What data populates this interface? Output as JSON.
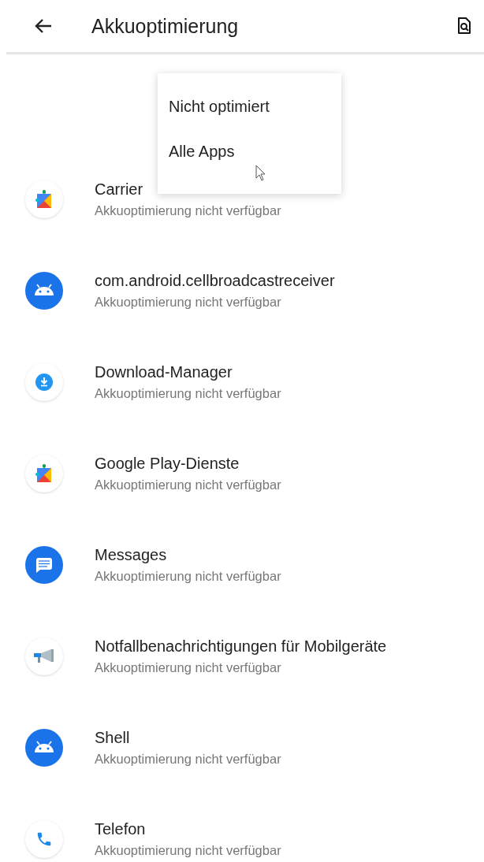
{
  "app_bar": {
    "title": "Akkuoptimierung"
  },
  "filter_menu": {
    "items": [
      "Nicht optimiert",
      "Alle Apps"
    ]
  },
  "apps": [
    {
      "name": "Carrier",
      "status": "Akkuoptimierung nicht verfügbar",
      "kind": "puzzle"
    },
    {
      "name": "com.android.cellbroadcastreceiver",
      "status": "Akkuoptimierung nicht verfügbar",
      "kind": "android"
    },
    {
      "name": "Download-Manager",
      "status": "Akkuoptimierung nicht verfügbar",
      "kind": "download"
    },
    {
      "name": "Google Play-Dienste",
      "status": "Akkuoptimierung nicht verfügbar",
      "kind": "puzzle"
    },
    {
      "name": "Messages",
      "status": "Akkuoptimierung nicht verfügbar",
      "kind": "messages"
    },
    {
      "name": "Notfallbenachrichtigungen für Mobilgeräte",
      "status": "Akkuoptimierung nicht verfügbar",
      "kind": "megaphone"
    },
    {
      "name": "Shell",
      "status": "Akkuoptimierung nicht verfügbar",
      "kind": "android"
    },
    {
      "name": "Telefon",
      "status": "Akkuoptimierung nicht verfügbar",
      "kind": "phone"
    }
  ]
}
